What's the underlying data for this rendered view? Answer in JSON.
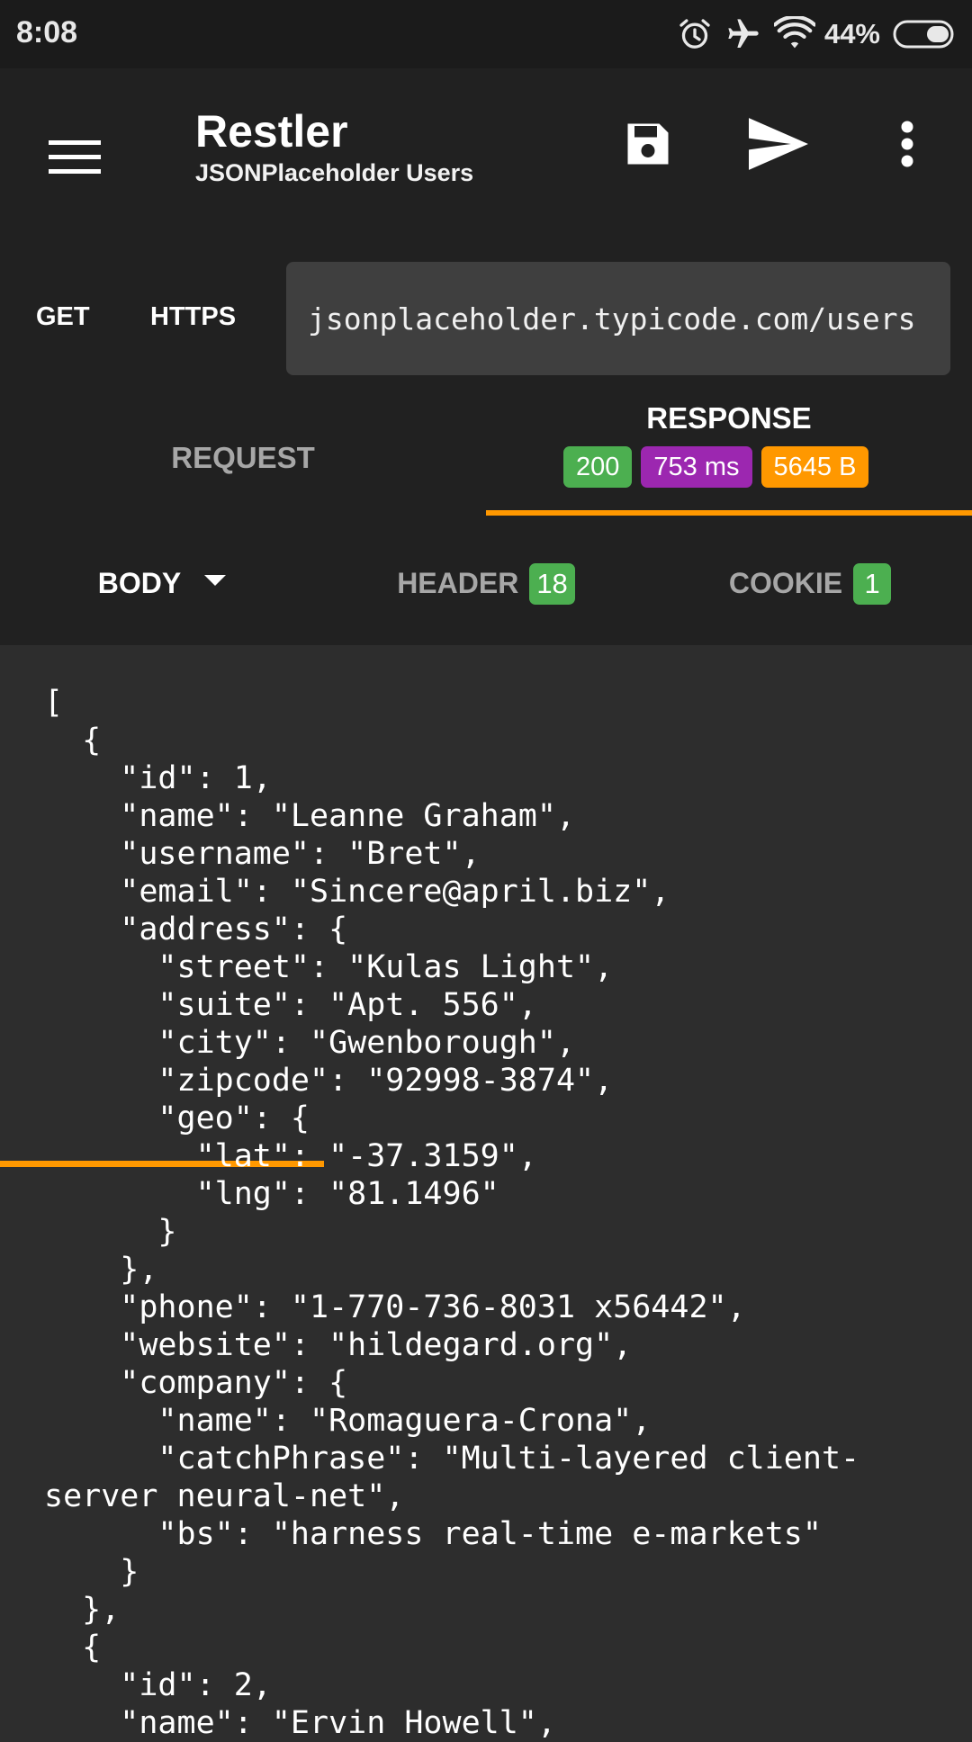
{
  "status_bar": {
    "time": "8:08",
    "battery_percent": "44%",
    "icons": [
      "alarm-icon",
      "airplane-icon",
      "wifi-icon",
      "battery-icon"
    ]
  },
  "app_bar": {
    "title": "Restler",
    "subtitle": "JSONPlaceholder Users",
    "actions": [
      "menu-icon",
      "save-icon",
      "send-icon",
      "more-vert-icon"
    ]
  },
  "request_line": {
    "method": "GET",
    "scheme": "HTTPS",
    "url": "jsonplaceholder.typicode.com/users"
  },
  "tabs": {
    "request": "REQUEST",
    "response": "RESPONSE",
    "status_code": "200",
    "time": "753 ms",
    "size": "5645 B"
  },
  "subtabs": {
    "body": "BODY",
    "header": "HEADER",
    "header_count": "18",
    "cookie": "COOKIE",
    "cookie_count": "1"
  },
  "colors": {
    "accent": "#ff9800",
    "status_ok": "#4caf50",
    "time_badge": "#9c27b0",
    "toolbar": "#212121",
    "content_bg": "#2d2d2d"
  },
  "response_body": "[\n  {\n    \"id\": 1,\n    \"name\": \"Leanne Graham\",\n    \"username\": \"Bret\",\n    \"email\": \"Sincere@april.biz\",\n    \"address\": {\n      \"street\": \"Kulas Light\",\n      \"suite\": \"Apt. 556\",\n      \"city\": \"Gwenborough\",\n      \"zipcode\": \"92998-3874\",\n      \"geo\": {\n        \"lat\": \"-37.3159\",\n        \"lng\": \"81.1496\"\n      }\n    },\n    \"phone\": \"1-770-736-8031 x56442\",\n    \"website\": \"hildegard.org\",\n    \"company\": {\n      \"name\": \"Romaguera-Crona\",\n      \"catchPhrase\": \"Multi-layered client-\nserver neural-net\",\n      \"bs\": \"harness real-time e-markets\"\n    }\n  },\n  {\n    \"id\": 2,\n    \"name\": \"Ervin Howell\","
}
